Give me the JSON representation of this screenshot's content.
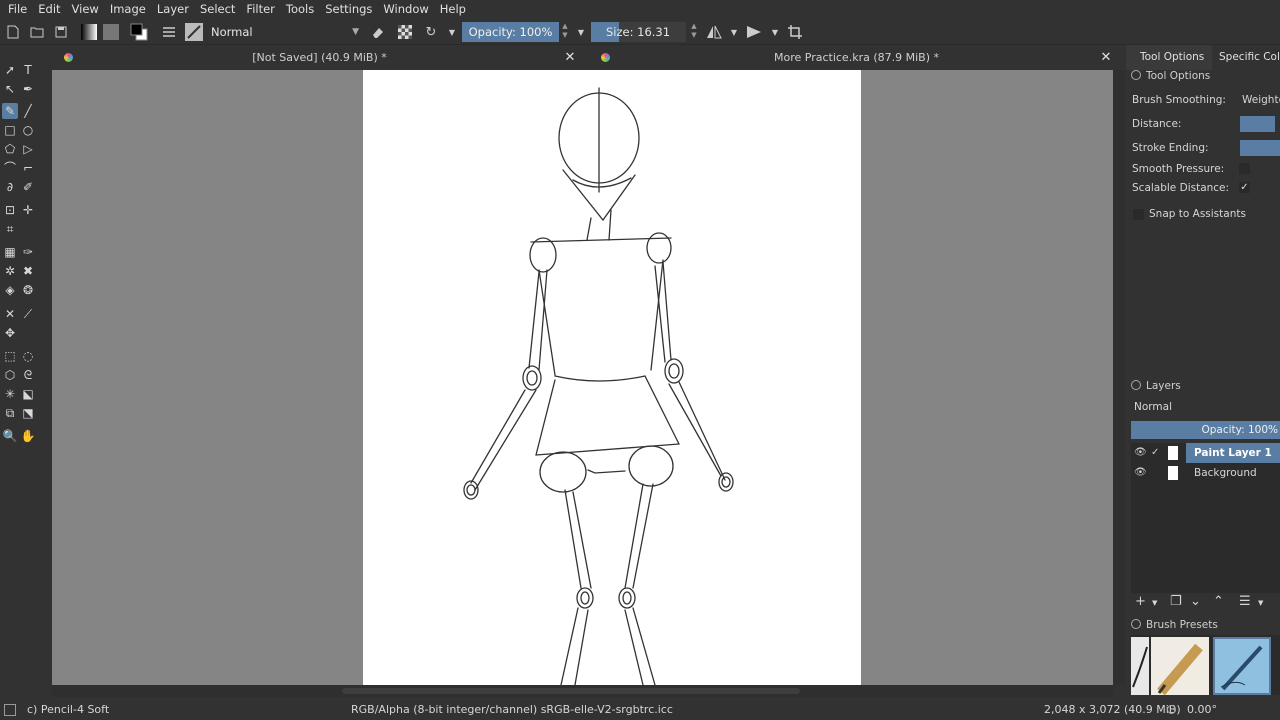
{
  "menu": [
    "File",
    "Edit",
    "View",
    "Image",
    "Layer",
    "Select",
    "Filter",
    "Tools",
    "Settings",
    "Window",
    "Help"
  ],
  "toolbar": {
    "blend_mode": "Normal",
    "opacity": "Opacity: 100%",
    "size": "Size: 16.31 px"
  },
  "tabs": [
    {
      "title": "[Not Saved]  (40.9 MiB) *"
    },
    {
      "title": "More Practice.kra  (87.9 MiB) *"
    }
  ],
  "dock": {
    "tabs": [
      "Tool Options",
      "Specific Color"
    ],
    "tool_options": {
      "title": "Tool Options",
      "brush_smoothing_label": "Brush Smoothing:",
      "brush_smoothing_value": "Weighted",
      "distance_label": "Distance:",
      "stroke_ending_label": "Stroke Ending:",
      "smooth_pressure_label": "Smooth Pressure:",
      "scalable_distance_label": "Scalable Distance:",
      "scalable_distance_checked": "✓",
      "snap_label": "Snap to Assistants"
    },
    "layers": {
      "title": "Layers",
      "blend_mode": "Normal",
      "opacity": "Opacity:  100%",
      "items": [
        {
          "name": "Paint Layer 1",
          "selected": true
        },
        {
          "name": "Background",
          "selected": false
        }
      ]
    },
    "brush_presets": {
      "title": "Brush Presets"
    }
  },
  "status": {
    "brush": "c) Pencil-4 Soft",
    "color_space": "RGB/Alpha (8-bit integer/channel)  sRGB-elle-V2-srgbtrc.icc",
    "dimensions": "2,048 x 3,072 (40.9 MiB)",
    "rotation": "0.00°"
  },
  "colors": {
    "accent": "#5a7ea3",
    "panel": "#323232",
    "canvas_bg": "#858585"
  }
}
